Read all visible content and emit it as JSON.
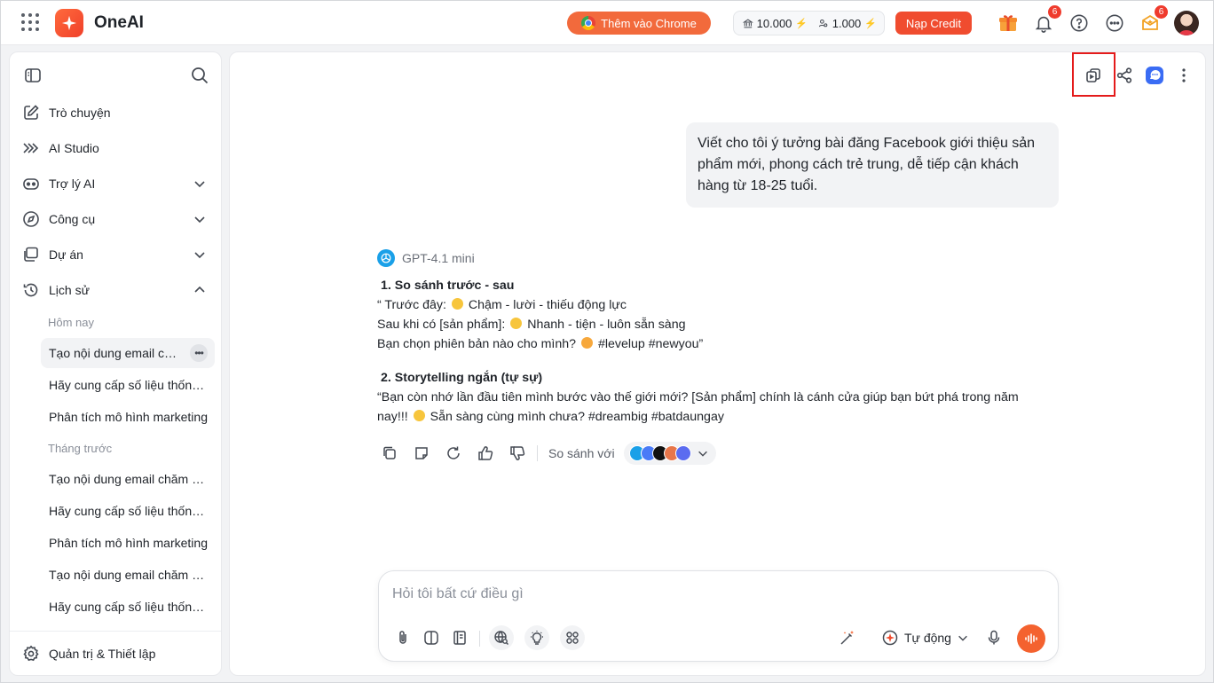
{
  "app": {
    "brand": "OneAI"
  },
  "topbar": {
    "chrome_button": "Thêm vào Chrome",
    "credit_a": "10.000",
    "credit_b": "1.000",
    "topup_button": "Nạp Credit",
    "notifications_badge": "6",
    "rewards_badge": "6",
    "icons": [
      "apps-grid-icon",
      "gift-icon",
      "bell-icon",
      "help-icon",
      "more-icon",
      "reward-icon"
    ]
  },
  "sidebar": {
    "nav": [
      {
        "label": "Trò chuyện",
        "icon": "edit-icon"
      },
      {
        "label": "AI Studio",
        "icon": "studio-icon"
      },
      {
        "label": "Trợ lý AI",
        "icon": "bot-icon"
      },
      {
        "label": "Công cụ",
        "icon": "compass-icon"
      },
      {
        "label": "Dự án",
        "icon": "folder-icon"
      },
      {
        "label": "Lịch sử",
        "icon": "history-icon"
      }
    ],
    "today_label": "Hôm nay",
    "today": [
      "Tạo nội dung email chăm sóc khách hàng",
      "Hãy cung cấp số liệu thống kê",
      "Phân tích mô hình marketing"
    ],
    "last_month_label": "Tháng trước",
    "last_month": [
      "Tạo nội dung email chăm sóc khách hàng",
      "Hãy cung cấp số liệu thống kê",
      "Phân tích mô hình marketing",
      "Tạo nội dung email chăm sóc khách hàng",
      "Hãy cung cấp số liệu thống kê"
    ],
    "settings": "Quản trị & Thiết lập"
  },
  "chat": {
    "user_message": "Viết cho tôi ý tưởng bài đăng Facebook giới thiệu sản phẩm mới, phong cách trẻ trung, dễ tiếp cận khách hàng từ 18-25 tuổi.",
    "model": "GPT-4.1 mini",
    "section1_title": "1. So sánh trước - sau",
    "s1_l1a": "“ Trước đây:",
    "s1_l1b": "Chậm - lười -  thiếu động lực",
    "s1_l2a": "Sau khi có [sản phẩm]:",
    "s1_l2b": "Nhanh - tiện - luôn sẵn sàng",
    "s1_l3a": "Bạn chọn phiên bản nào cho mình?",
    "s1_l3b": "#levelup #newyou”",
    "section2_title": "2. Storytelling ngắn (tự sự)",
    "s2_l1": "“Bạn còn nhớ lần đầu tiên mình bước vào thế giới mới? [Sản phẩm] chính là cánh cửa giúp bạn bứt phá trong năm",
    "s2_l2a": "nay!!!",
    "s2_l2b": "Sẵn sàng cùng mình chưa? #dreambig #batdaungay",
    "compare_label": "So sánh với"
  },
  "composer": {
    "placeholder": "Hỏi tôi bất cứ điều gì",
    "mode": "Tự động"
  },
  "colors": {
    "accent": "#f4622f",
    "danger": "#e41b1b",
    "brand_blue": "#3a6cf4"
  }
}
